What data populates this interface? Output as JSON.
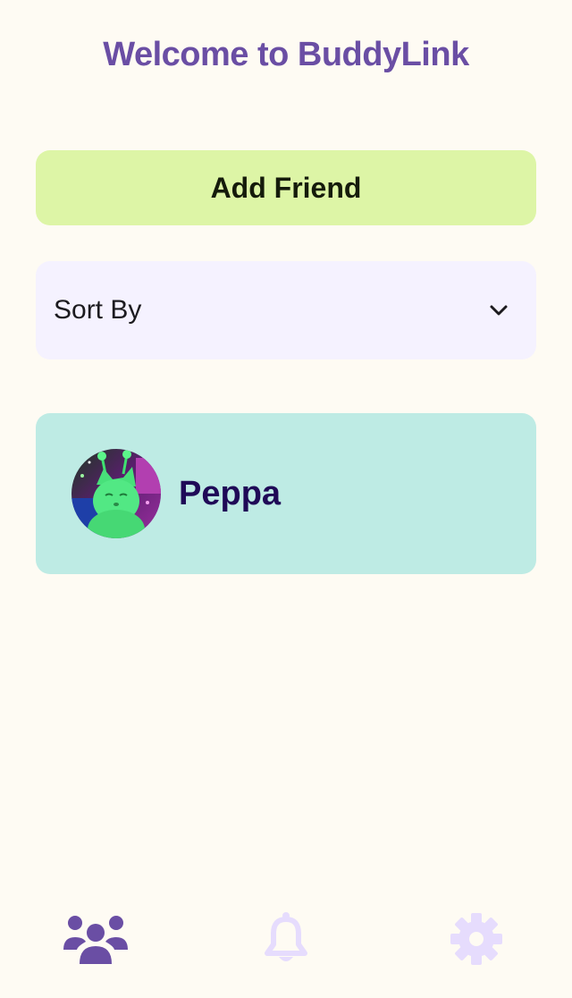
{
  "header": {
    "title": "Welcome to BuddyLink"
  },
  "actions": {
    "add_friend_label": "Add Friend"
  },
  "sort": {
    "label": "Sort By",
    "icon": "chevron-down-icon"
  },
  "friends": [
    {
      "name": "Peppa",
      "avatar": "alien-cat-avatar"
    }
  ],
  "bottom_nav": {
    "items": [
      {
        "icon": "friends-icon",
        "active": true
      },
      {
        "icon": "bell-icon",
        "active": false
      },
      {
        "icon": "gear-icon",
        "active": false
      }
    ]
  },
  "colors": {
    "background": "#FEFBF3",
    "title": "#6A4EA4",
    "add_button": "#DDF5A6",
    "sort_bg": "#F5F2FF",
    "card_bg": "#BEEBE4",
    "friend_name": "#1F0A57",
    "nav_active": "#6A4EA4",
    "nav_inactive": "#E6DCFD"
  }
}
